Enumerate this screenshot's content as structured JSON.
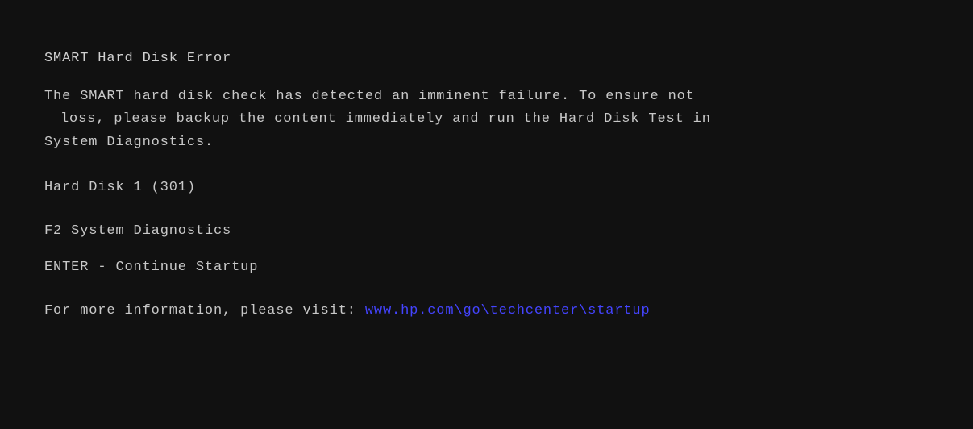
{
  "screen": {
    "background_color": "#111111",
    "text_color": "#c8c8c8",
    "link_color": "#4444ff"
  },
  "error_title": "SMART Hard Disk Error",
  "error_description_line1": "The SMART hard disk check has detected an imminent failure.  To ensure not",
  "error_description_line2": "loss, please backup the content immediately and run the Hard Disk Test in",
  "error_description_line3": "System Diagnostics.",
  "disk_info": "Hard Disk 1 (301)",
  "action_f2_key": "F2",
  "action_f2_label": "System Diagnostics",
  "action_enter_key": "ENTER",
  "action_enter_sep": "-",
  "action_enter_label": "Continue Startup",
  "more_info_prefix": "For more information, please visit:",
  "more_info_link": "www.hp.com\\go\\techcenter\\startup"
}
